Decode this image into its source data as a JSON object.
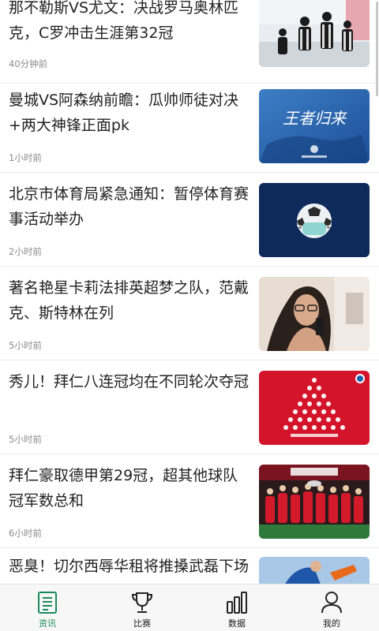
{
  "news": [
    {
      "title": "那不勒斯VS尤文：决战罗马奥林匹克，C罗冲击生涯第32冠",
      "time": "40分钟前",
      "image": "juventus-players-celebrating"
    },
    {
      "title": "曼城VS阿森纳前瞻：瓜帅师徒对决+两大神锋正面pk",
      "time": "1小时前",
      "image": "blue-poster-wangzhe-guilai"
    },
    {
      "title": "北京市体育局紧急通知：暂停体育赛事活动举办",
      "time": "2小时前",
      "image": "football-with-face-mask"
    },
    {
      "title": "著名艳星卡莉法排英超梦之队，范戴克、斯特林在列",
      "time": "5小时前",
      "image": "woman-selfie-portrait"
    },
    {
      "title": "秀儿！拜仁八连冠均在不同轮次夺冠",
      "time": "5小时前",
      "image": "bayern-players-pyramid-red"
    },
    {
      "title": "拜仁豪取德甲第29冠，超其他球队冠军数总和",
      "time": "6小时前",
      "image": "bayern-trophy-celebration"
    },
    {
      "title": "恶臭！切尔西辱华租将推搡武磊下场",
      "time": "",
      "image": "football-tackle"
    }
  ],
  "tabbar": {
    "tabs": [
      {
        "label": "资讯",
        "icon": "news-document-icon",
        "active": true
      },
      {
        "label": "比赛",
        "icon": "trophy-icon",
        "active": false
      },
      {
        "label": "数据",
        "icon": "bar-chart-icon",
        "active": false
      },
      {
        "label": "我的",
        "icon": "user-icon",
        "active": false
      }
    ]
  },
  "poster_text": "王者归来",
  "colors": {
    "accent": "#1a8a5e",
    "text": "#222222",
    "muted": "#8a8a8a"
  }
}
